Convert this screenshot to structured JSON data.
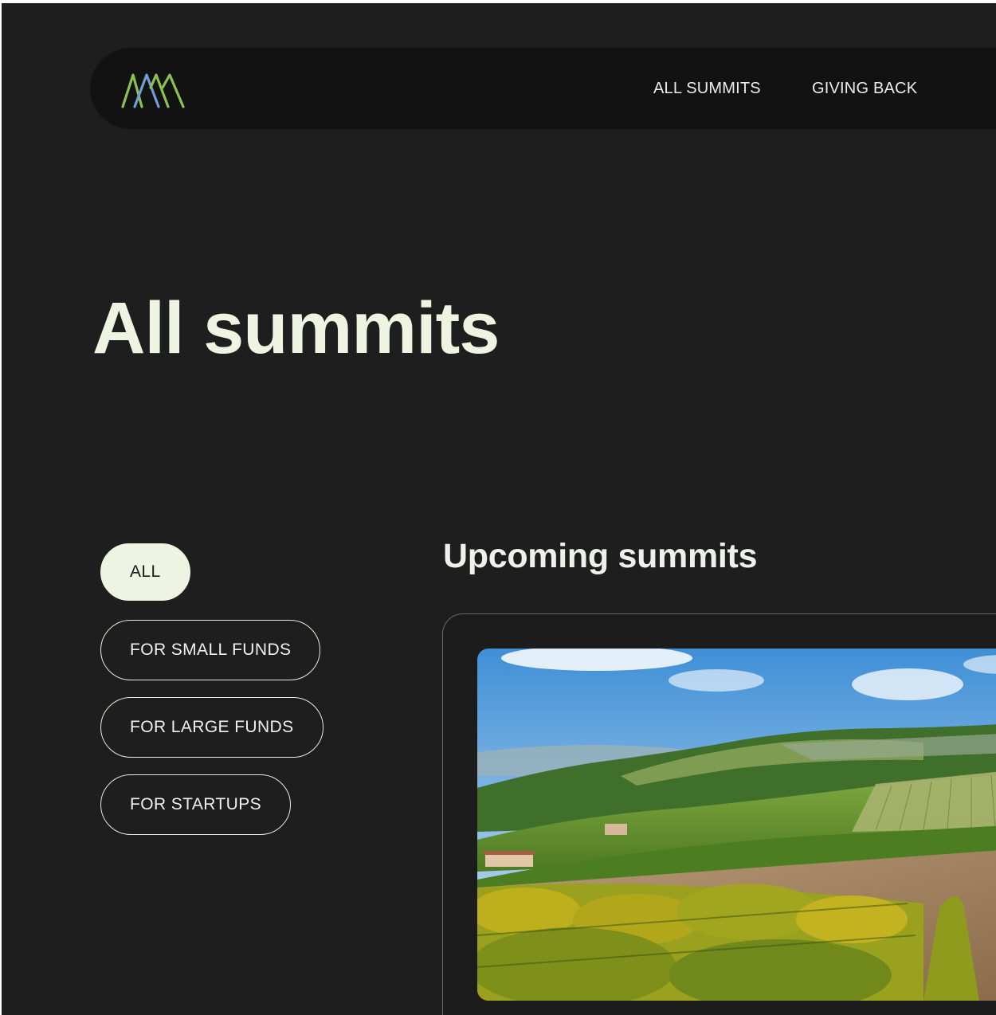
{
  "nav": {
    "logo_icon": "mountain-peaks-logo",
    "links": [
      "ALL SUMMITS",
      "GIVING BACK"
    ]
  },
  "page": {
    "title": "All summits"
  },
  "filters": {
    "items": [
      "ALL",
      "FOR SMALL FUNDS",
      "FOR LARGE FUNDS",
      "FOR STARTUPS"
    ],
    "active": "ALL"
  },
  "upcoming": {
    "heading": "Upcoming summits",
    "card_image_icon": "vineyard-landscape-photo"
  },
  "colors": {
    "background": "#1e1e1e",
    "navbar": "#121212",
    "accent_text": "#eef4e2",
    "logo_green": "#8cc152",
    "logo_blue": "#6f9fd4"
  }
}
